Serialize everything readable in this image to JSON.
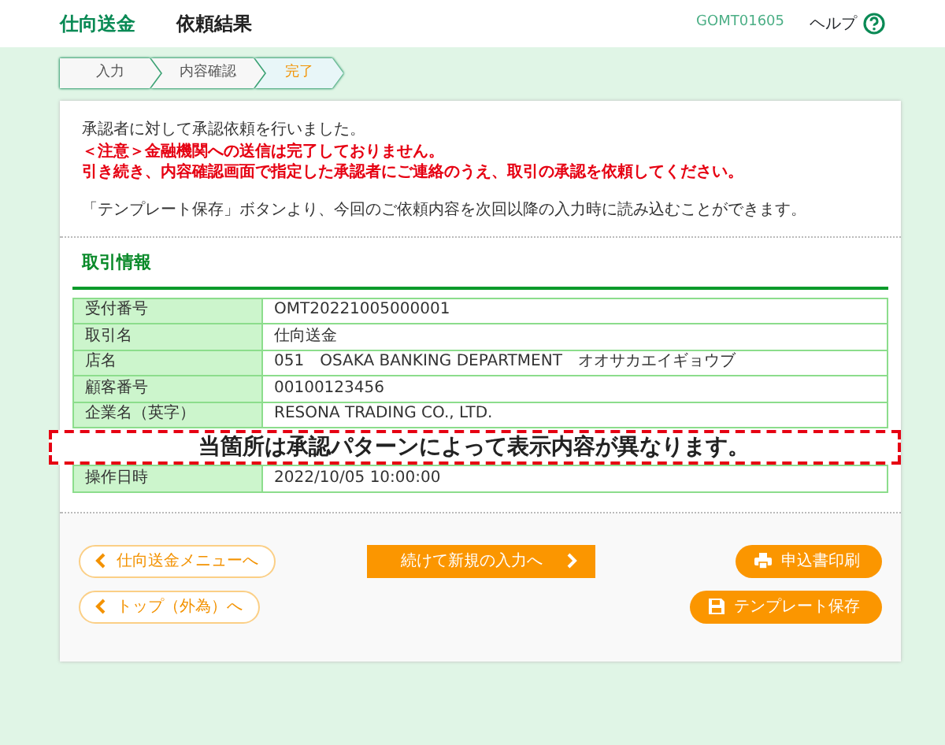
{
  "header": {
    "service": "仕向送金",
    "page_title": "依頼結果",
    "screen_id": "GOMT01605",
    "help": "ヘルプ"
  },
  "steps": [
    {
      "label": "入力",
      "selected": false
    },
    {
      "label": "内容確認",
      "selected": false
    },
    {
      "label": "完了",
      "selected": true
    }
  ],
  "messages": [
    {
      "kind": "info",
      "text": "承認者に対して承認依頼を行いました。"
    },
    {
      "kind": "warning",
      "text": "＜注意＞金融機関への送信は完了しておりません。"
    },
    {
      "kind": "warning",
      "text": "引き続き、内容確認画面で指定した承認者にご連絡のうえ、取引の承認を依頼してください。"
    },
    {
      "kind": "note",
      "text": "「テンプレート保存」ボタンより、今回のご依頼内容を次回以降の入力時に読み込むことができます。"
    }
  ],
  "section": {
    "title": "取引情報",
    "rows": [
      {
        "label": "受付番号",
        "value": "OMT20221005000001"
      },
      {
        "label": "取引名",
        "value": "仕向送金"
      },
      {
        "label": "店名",
        "value": "051　OSAKA BANKING DEPARTMENT　オオサカエイギョウブ"
      },
      {
        "label": "顧客番号",
        "value": "00100123456"
      },
      {
        "label": "企業名（英字）",
        "value": "RESONA TRADING CO., LTD."
      },
      {
        "label": "操作日時",
        "value": "2022/10/05 10:00:00"
      }
    ]
  },
  "notice": "当箇所は承認パターンによって表示内容が異なります。",
  "buttons": [
    {
      "kind": "back",
      "label": "仕向送金メニューへ"
    },
    {
      "kind": "next",
      "label": "続けて新規の入力へ"
    },
    {
      "kind": "print",
      "label": "申込書印刷"
    },
    {
      "kind": "back",
      "label": "トップ（外為）へ"
    },
    {
      "kind": "save",
      "label": "テンプレート保存"
    }
  ]
}
